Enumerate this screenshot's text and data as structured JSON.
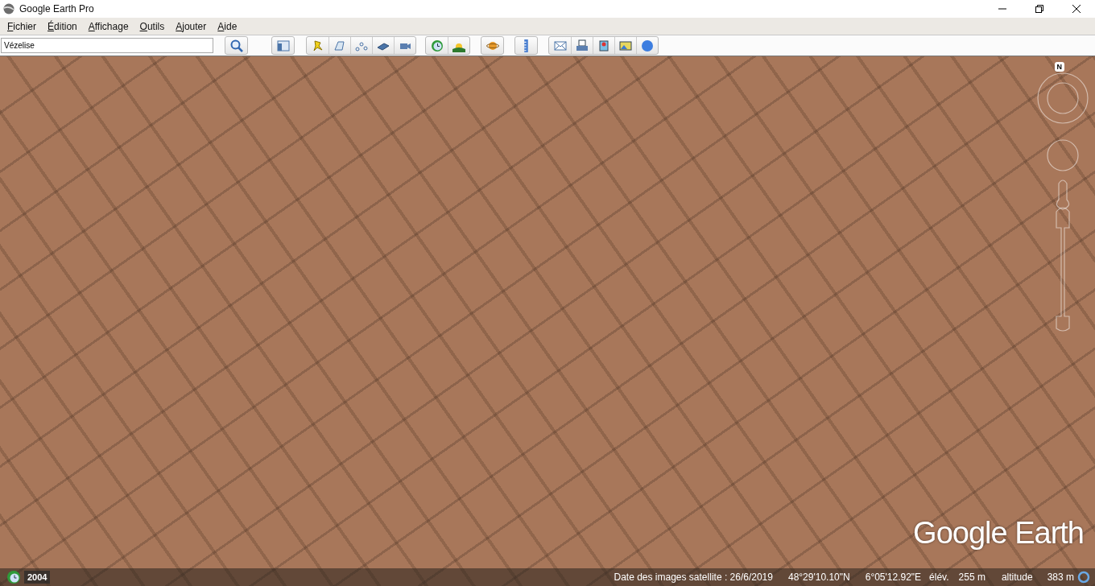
{
  "window": {
    "title": "Google Earth Pro"
  },
  "menu": [
    "Fichier",
    "Édition",
    "Affichage",
    "Outils",
    "Ajouter",
    "Aide"
  ],
  "search": {
    "value": "Vézelise"
  },
  "map": {
    "logo": "Google Earth",
    "north_label": "N"
  },
  "historical_imagery": {
    "year": "2004"
  },
  "status_bar": {
    "imagery_date": "Date des images satellite : 26/6/2019",
    "latitude": "48°29'10.10\"N",
    "longitude": "6°05'12.92\"E",
    "elevation_label": "élév.",
    "elevation": "255 m",
    "altitude_label": "altitude",
    "altitude": "383 m"
  }
}
